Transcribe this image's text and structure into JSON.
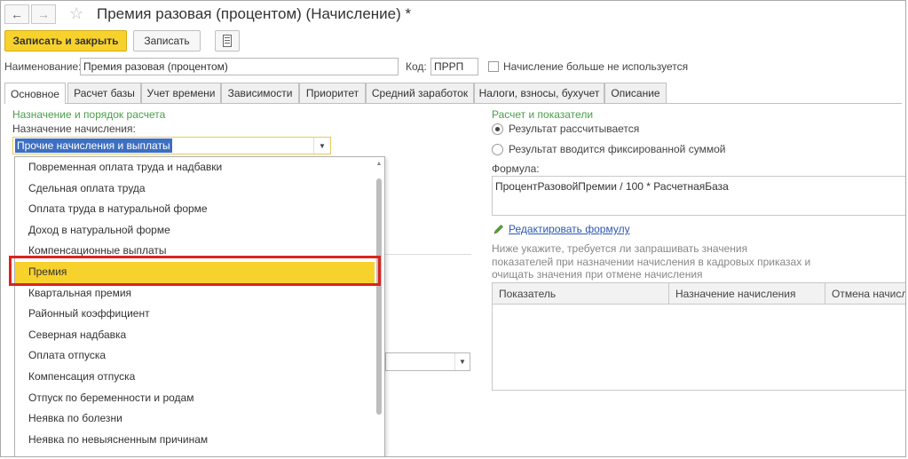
{
  "window": {
    "title": "Премия разовая (процентом) (Начисление) *"
  },
  "toolbar": {
    "save_close": "Записать и закрыть",
    "save": "Записать"
  },
  "form": {
    "name_label": "Наименование:",
    "name_value": "Премия разовая (процентом)",
    "code_label": "Код:",
    "code_value": "ПРРП",
    "unused_label": "Начисление больше не используется"
  },
  "tabs": [
    "Основное",
    "Расчет базы",
    "Учет времени",
    "Зависимости",
    "Приоритет",
    "Средний заработок",
    "Налоги, взносы, бухучет",
    "Описание"
  ],
  "left": {
    "section_title": "Назначение и порядок расчета",
    "purpose_label": "Назначение начисления:",
    "purpose_value": "Прочие начисления и выплаты",
    "dropdown_items": [
      "Повременная оплата труда и надбавки",
      "Сдельная оплата труда",
      "Оплата труда в натуральной форме",
      "Доход в натуральной форме",
      "Компенсационные выплаты",
      "Премия",
      "Квартальная премия",
      "Районный коэффициент",
      "Северная надбавка",
      "Оплата отпуска",
      "Компенсация отпуска",
      "Отпуск по беременности и родам",
      "Неявка по болезни",
      "Неявка по невыясненным причинам"
    ]
  },
  "right": {
    "section_title": "Расчет и показатели",
    "radio1": "Результат рассчитывается",
    "radio2": "Результат вводится фиксированной суммой",
    "formula_label": "Формула:",
    "formula_value": "ПроцентРазовойПремии / 100 * РасчетнаяБаза",
    "edit_link": "Редактировать формулу",
    "note": "Ниже укажите, требуется ли запрашивать значения показателей при назначении начисления в кадровых приказах и очищать значения при отмене начисления",
    "table_headers": [
      "Показатель",
      "Назначение начисления",
      "Отмена начисле"
    ]
  },
  "colors": {
    "accent": "#f8d22c",
    "highlight_border": "#d9241c",
    "section_green": "#4a9e4a",
    "link": "#2b58b4",
    "selection": "#3d6fc2"
  }
}
